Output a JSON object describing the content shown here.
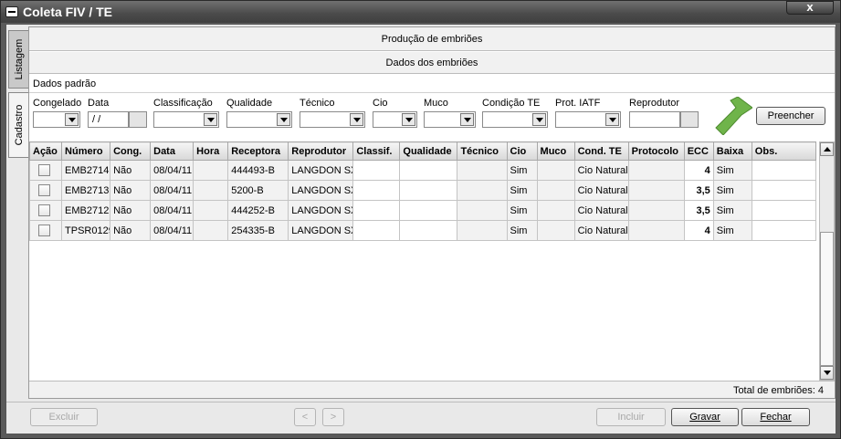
{
  "window": {
    "title": "Coleta FIV / TE",
    "close_label": "x"
  },
  "side_tabs": {
    "listagem": "Listagem",
    "cadastro": "Cadastro"
  },
  "headers": {
    "section1": "Produção de embriões",
    "section2": "Dados dos embriões"
  },
  "defaults": {
    "title": "Dados padrão",
    "labels": {
      "congelado": "Congelado",
      "data": "Data",
      "classificacao": "Classificação",
      "qualidade": "Qualidade",
      "tecnico": "Técnico",
      "cio": "Cio",
      "muco": "Muco",
      "condicao_te": "Condição TE",
      "prot_iatf": "Prot. IATF",
      "reprodutor": "Reprodutor"
    },
    "data_value": " / /",
    "preencher": "Preencher"
  },
  "grid": {
    "columns": [
      "Ação",
      "Número",
      "Cong.",
      "Data",
      "Hora",
      "Receptora",
      "Reprodutor",
      "Classif.",
      "Qualidade",
      "Técnico",
      "Cio",
      "Muco",
      "Cond. TE",
      "Protocolo",
      "ECC",
      "Baixa",
      "Obs."
    ],
    "rows": [
      {
        "numero": "EMB2714",
        "cong": "Não",
        "data": "08/04/11",
        "hora": "",
        "receptora": "444493-B",
        "reprodutor": "LANGDON SX",
        "classif": "",
        "qualidade": "",
        "tecnico": "",
        "cio": "Sim",
        "muco": "",
        "cond_te": "Cio Natural",
        "protocolo": "",
        "ecc": "4",
        "baixa": "Sim",
        "obs": ""
      },
      {
        "numero": "EMB2713",
        "cong": "Não",
        "data": "08/04/11",
        "hora": "",
        "receptora": "5200-B",
        "reprodutor": "LANGDON SX",
        "classif": "",
        "qualidade": "",
        "tecnico": "",
        "cio": "Sim",
        "muco": "",
        "cond_te": "Cio Natural",
        "protocolo": "",
        "ecc": "3,5",
        "baixa": "Sim",
        "obs": ""
      },
      {
        "numero": "EMB2712",
        "cong": "Não",
        "data": "08/04/11",
        "hora": "",
        "receptora": "444252-B",
        "reprodutor": "LANGDON SX",
        "classif": "",
        "qualidade": "",
        "tecnico": "",
        "cio": "Sim",
        "muco": "",
        "cond_te": "Cio Natural",
        "protocolo": "",
        "ecc": "3,5",
        "baixa": "Sim",
        "obs": ""
      },
      {
        "numero": "TPSR0129",
        "cong": "Não",
        "data": "08/04/11",
        "hora": "",
        "receptora": "254335-B",
        "reprodutor": "LANGDON SX",
        "classif": "",
        "qualidade": "",
        "tecnico": "",
        "cio": "Sim",
        "muco": "",
        "cond_te": "Cio Natural",
        "protocolo": "",
        "ecc": "4",
        "baixa": "Sim",
        "obs": ""
      }
    ],
    "total": "Total de embriões: 4"
  },
  "buttons": {
    "excluir": "Excluir",
    "prev": "<",
    "next": ">",
    "incluir": "Incluir",
    "gravar": "Gravar",
    "fechar": "Fechar"
  },
  "colors": {
    "accent_arrow": "#6fb44a",
    "titlebar": "#4a4a4a"
  }
}
